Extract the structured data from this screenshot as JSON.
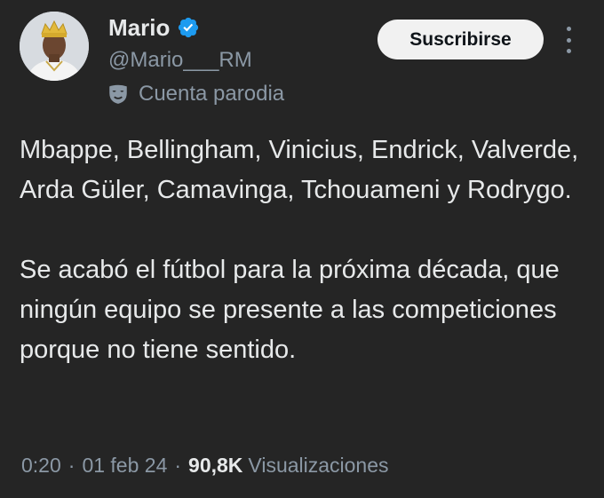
{
  "author": {
    "display_name": "Mario",
    "handle": "@Mario___RM",
    "verified": true,
    "verified_color": "#1d9bf0",
    "parody_label": "Cuenta parodia",
    "parody_icon": "mask-icon",
    "avatar": "avatar-icon"
  },
  "actions": {
    "subscribe_label": "Suscribirse",
    "more_icon": "more-vertical-icon"
  },
  "tweet": {
    "paragraphs": [
      "Mbappe, Bellingham, Vinicius, Endrick, Valverde, Arda Güler, Camavinga, Tchouameni y Rodrygo.",
      "Se acabó el fútbol para la próxima década, que ningún equipo se presente a las competiciones porque no tiene sentido."
    ]
  },
  "meta": {
    "time": "0:20",
    "separator": "·",
    "date": "01 feb 24",
    "views_count": "90,8K",
    "views_label": "Visualizaciones"
  },
  "colors": {
    "background": "#252525",
    "primary_text": "#e7e9ea",
    "secondary_text": "#8b98a5",
    "button_bg": "#f1f1f1"
  }
}
